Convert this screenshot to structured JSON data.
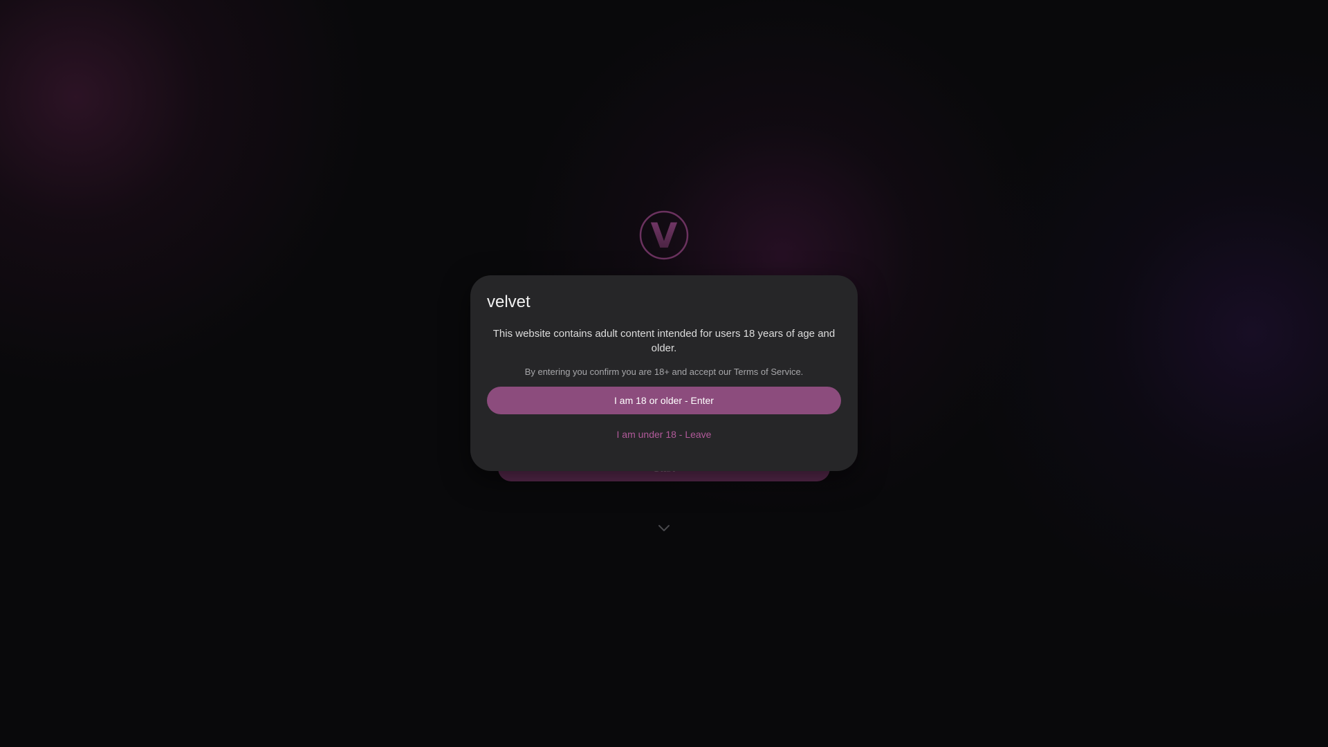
{
  "brand": {
    "logo_letter": "V",
    "accent_color": "#8c4c7d"
  },
  "hero": {
    "button_label": "Start"
  },
  "age_gate": {
    "title": "velvet",
    "message": "This website contains adult content intended for users 18 years of age and older.",
    "confirm_note": "By entering you confirm you are 18+ and accept our Terms of Service.",
    "enter_label": "I am 18 or older - Enter",
    "leave_label": "I am under 18 - Leave"
  },
  "icons": {
    "logo": "v-monogram-icon",
    "scroll": "chevron-down-icon"
  }
}
